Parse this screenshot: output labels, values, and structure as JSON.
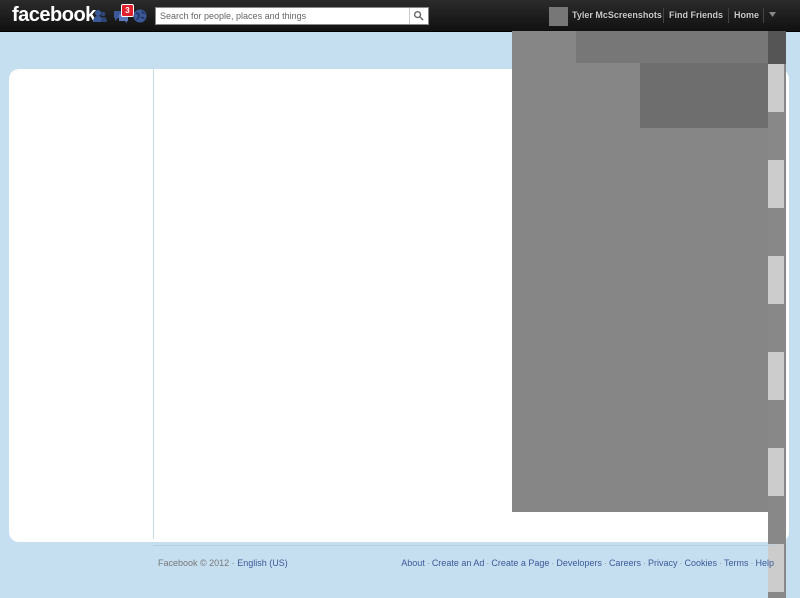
{
  "header": {
    "logo": "facebook",
    "notifications_badge": "3",
    "search_placeholder": "Search for people, places and things",
    "user_name": "Tyler McScreenshots",
    "find_friends": "Find Friends",
    "home": "Home"
  },
  "footer": {
    "copyright": "Facebook © 2012 ·",
    "language": "English (US)",
    "links": [
      "About",
      "Create an Ad",
      "Create a Page",
      "Developers",
      "Careers",
      "Privacy",
      "Cookies",
      "Terms",
      "Help"
    ]
  },
  "colors": {
    "page_background": "#c6dff0",
    "topbar": "#1a1a1a",
    "link": "#3b5998",
    "badge": "#e0202a"
  },
  "icons": [
    "friend-requests-icon",
    "messages-icon",
    "notifications-globe-icon",
    "search-icon",
    "account-caret-icon"
  ]
}
